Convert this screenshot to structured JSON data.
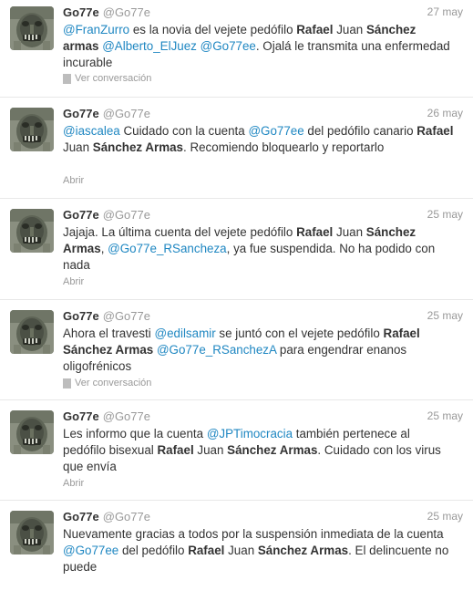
{
  "tweets": [
    {
      "name": "Go77e",
      "handle": "@Go77e",
      "time": "27 may",
      "text": [
        {
          "t": "@FranZurro",
          "k": "mention"
        },
        {
          "t": " es la novia del vejete pedófilo "
        },
        {
          "t": "Rafael",
          "k": "bold"
        },
        {
          "t": " Juan "
        },
        {
          "t": "Sánchez armas",
          "k": "bold"
        },
        {
          "t": " "
        },
        {
          "t": "@Alberto_ElJuez",
          "k": "mention"
        },
        {
          "t": " "
        },
        {
          "t": "@Go77ee",
          "k": "mention"
        },
        {
          "t": ". Ojalá le transmita una enfermedad incurable"
        }
      ],
      "action": "Ver conversación",
      "action_icon": "conversation-icon"
    },
    {
      "name": "Go77e",
      "handle": "@Go77e",
      "time": "26 may",
      "text": [
        {
          "t": "@iascalea",
          "k": "mention"
        },
        {
          "t": " Cuidado con la cuenta "
        },
        {
          "t": "@Go77ee",
          "k": "mention"
        },
        {
          "t": " del pedófilo canario "
        },
        {
          "t": "Rafael",
          "k": "bold"
        },
        {
          "t": " Juan "
        },
        {
          "t": "Sánchez Armas",
          "k": "bold"
        },
        {
          "t": ". Recomiendo bloquearlo y reportarlo"
        }
      ],
      "action": "Abrir",
      "action_icon": ""
    },
    {
      "name": "Go77e",
      "handle": "@Go77e",
      "time": "25 may",
      "text": [
        {
          "t": "Jajaja. La última cuenta del vejete pedófilo "
        },
        {
          "t": "Rafael",
          "k": "bold"
        },
        {
          "t": " Juan "
        },
        {
          "t": "Sánchez Armas",
          "k": "bold"
        },
        {
          "t": ", "
        },
        {
          "t": "@Go77e_RSancheza",
          "k": "mention"
        },
        {
          "t": ", ya fue suspendida. No ha podido con nada"
        }
      ],
      "action": "Abrir",
      "action_icon": ""
    },
    {
      "name": "Go77e",
      "handle": "@Go77e",
      "time": "25 may",
      "text": [
        {
          "t": "Ahora el travesti "
        },
        {
          "t": "@edilsamir",
          "k": "mention"
        },
        {
          "t": " se juntó con el vejete pedófilo "
        },
        {
          "t": "Rafael Sánchez Armas",
          "k": "bold"
        },
        {
          "t": " "
        },
        {
          "t": "@Go77e_RSanchezA",
          "k": "mention"
        },
        {
          "t": " para engendrar enanos oligofrénicos"
        }
      ],
      "action": "Ver conversación",
      "action_icon": "conversation-icon"
    },
    {
      "name": "Go77e",
      "handle": "@Go77e",
      "time": "25 may",
      "text": [
        {
          "t": "Les informo que la cuenta "
        },
        {
          "t": "@JPTimocracia",
          "k": "mention"
        },
        {
          "t": " también pertenece al pedófilo bisexual "
        },
        {
          "t": "Rafael",
          "k": "bold"
        },
        {
          "t": " Juan "
        },
        {
          "t": "Sánchez Armas",
          "k": "bold"
        },
        {
          "t": ". Cuidado con los virus que envía"
        }
      ],
      "action": "Abrir",
      "action_icon": ""
    },
    {
      "name": "Go77e",
      "handle": "@Go77e",
      "time": "25 may",
      "text": [
        {
          "t": "Nuevamente gracias a todos por la suspensión inmediata de la cuenta "
        },
        {
          "t": "@Go77ee",
          "k": "mention"
        },
        {
          "t": " del pedófilo "
        },
        {
          "t": "Rafael",
          "k": "bold"
        },
        {
          "t": " Juan "
        },
        {
          "t": "Sánchez Armas",
          "k": "bold"
        },
        {
          "t": ". El delincuente no puede"
        }
      ],
      "action": "",
      "action_icon": ""
    }
  ],
  "colors": {
    "link": "#1f87c2",
    "muted": "#999999",
    "text": "#333333",
    "divider": "#e8e8e8"
  }
}
